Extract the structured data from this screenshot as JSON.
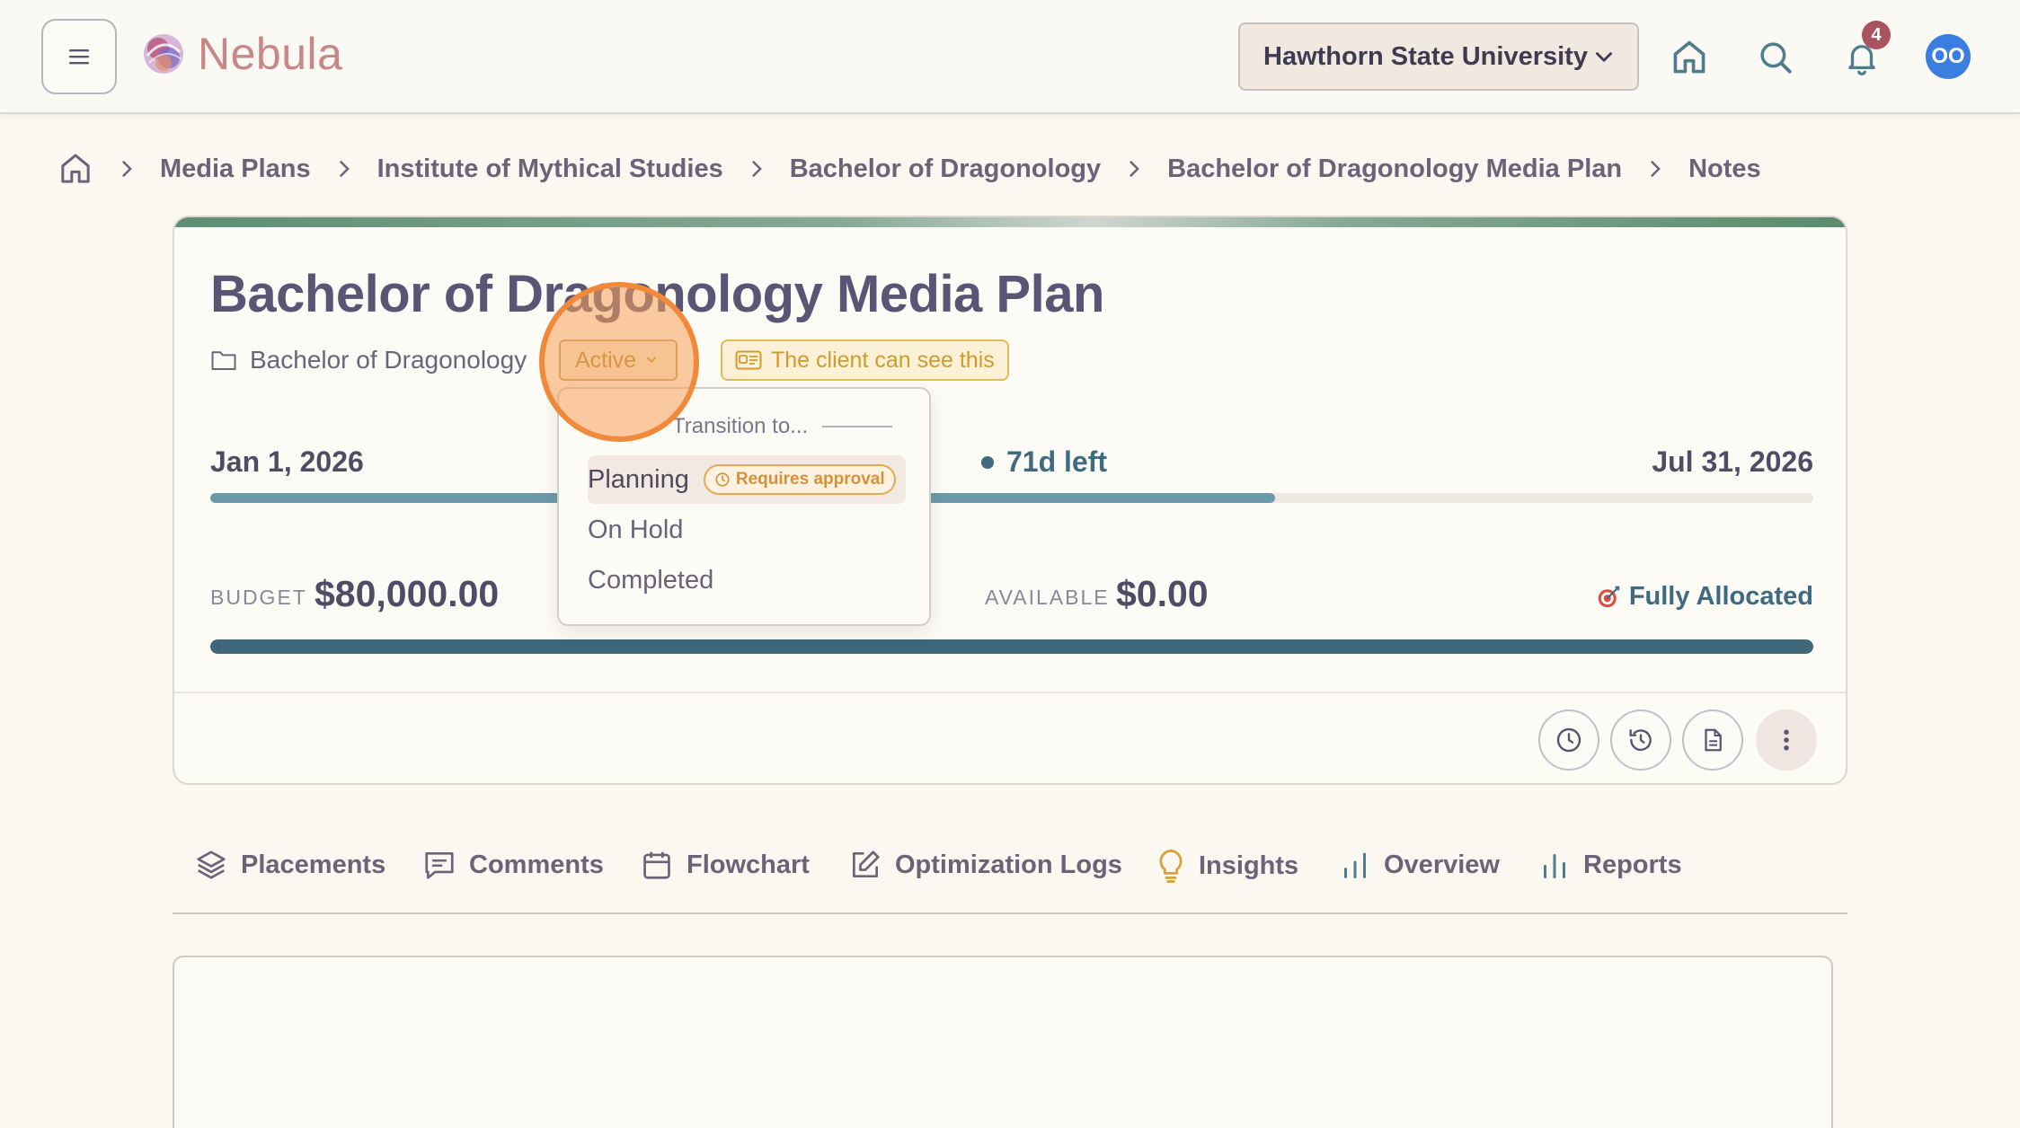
{
  "header": {
    "app_name": "Nebula",
    "organization": "Hawthorn State University",
    "notification_count": "4",
    "avatar_initials": "OO",
    "icons": [
      "menu-icon",
      "nebula-logo",
      "chevron-down-icon",
      "home-icon",
      "search-icon",
      "bell-icon"
    ]
  },
  "breadcrumb": {
    "items": [
      "Media Plans",
      "Institute of Mythical Studies",
      "Bachelor of Dragonology",
      "Bachelor of Dragonology Media Plan",
      "Notes"
    ]
  },
  "plan": {
    "title": "Bachelor of Dragonology Media Plan",
    "program": "Bachelor of Dragonology",
    "status": "Active",
    "client_visibility": "The client can see this",
    "start_date": "Jan 1, 2026",
    "end_date": "Jul 31, 2026",
    "time_left": "71d left",
    "time_progress": 0.664,
    "budget_label": "BUDGET",
    "budget_value": "$80,000.00",
    "available_label": "AVAILABLE",
    "available_value": "$0.00",
    "allocation_status": "Fully Allocated",
    "budget_progress": 1.0
  },
  "status_dropdown": {
    "header": "Transition to...",
    "options": [
      {
        "label": "Planning",
        "badge": "Requires approval",
        "highlighted": true
      },
      {
        "label": "On Hold"
      },
      {
        "label": "Completed"
      }
    ]
  },
  "card_actions": [
    "clock-icon",
    "history-icon",
    "document-icon",
    "more-vertical-icon"
  ],
  "tabs": [
    {
      "label": "Placements",
      "icon": "layers-icon"
    },
    {
      "label": "Comments",
      "icon": "comment-icon"
    },
    {
      "label": "Flowchart",
      "icon": "calendar-icon"
    },
    {
      "label": "Optimization Logs",
      "icon": "edit-icon"
    },
    {
      "label": "Insights",
      "icon": "lightbulb-icon"
    },
    {
      "label": "Overview",
      "icon": "bar-chart-icon"
    },
    {
      "label": "Reports",
      "icon": "bar-chart-icon"
    }
  ],
  "colors": {
    "background": "#fbf8f1",
    "accent_teal": "#3f6679",
    "status_gold": "#b08b2b",
    "badge_orange": "#d7913a",
    "notification": "#a8545f",
    "avatar": "#3a7ee0",
    "cursor_highlight": "#f2883a"
  }
}
